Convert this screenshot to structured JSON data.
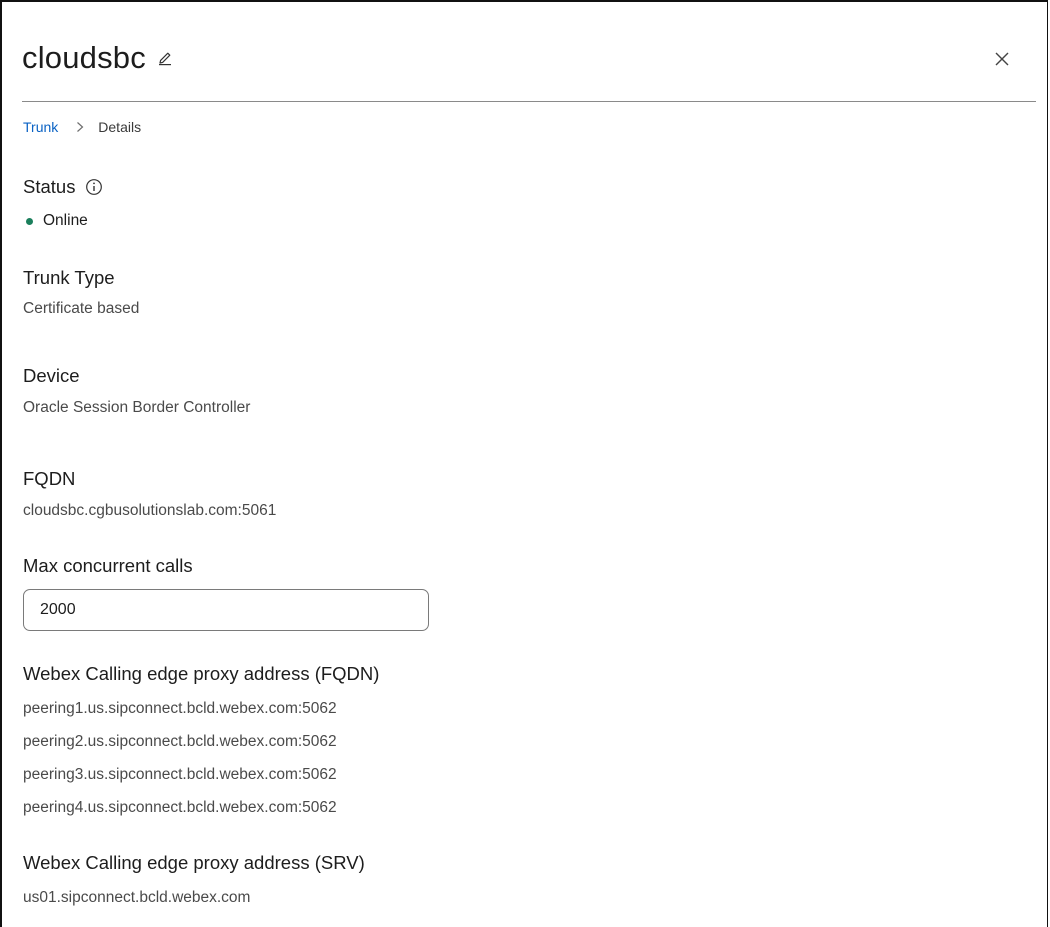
{
  "header": {
    "title": "cloudsbc",
    "edit_icon": "pencil-icon",
    "close_icon": "close-icon"
  },
  "breadcrumb": {
    "parent": "Trunk",
    "separator_icon": "chevron-right-icon",
    "current": "Details"
  },
  "status": {
    "label": "Status",
    "info_icon": "info-icon",
    "value": "Online",
    "color": "#1b7f5c"
  },
  "trunk_type": {
    "label": "Trunk Type",
    "value": "Certificate based"
  },
  "device": {
    "label": "Device",
    "value": "Oracle Session Border Controller"
  },
  "fqdn": {
    "label": "FQDN",
    "value": "cloudsbc.cgbusolutionslab.com:5061"
  },
  "max_calls": {
    "label": "Max concurrent calls",
    "value": "2000"
  },
  "edge_proxy_fqdn": {
    "label": "Webex Calling edge proxy address (FQDN)",
    "values": [
      "peering1.us.sipconnect.bcld.webex.com:5062",
      "peering2.us.sipconnect.bcld.webex.com:5062",
      "peering3.us.sipconnect.bcld.webex.com:5062",
      "peering4.us.sipconnect.bcld.webex.com:5062"
    ]
  },
  "edge_proxy_srv": {
    "label": "Webex Calling edge proxy address (SRV)",
    "value": "us01.sipconnect.bcld.webex.com"
  },
  "colors": {
    "link": "#0a62c4",
    "online": "#1b7f5c"
  }
}
